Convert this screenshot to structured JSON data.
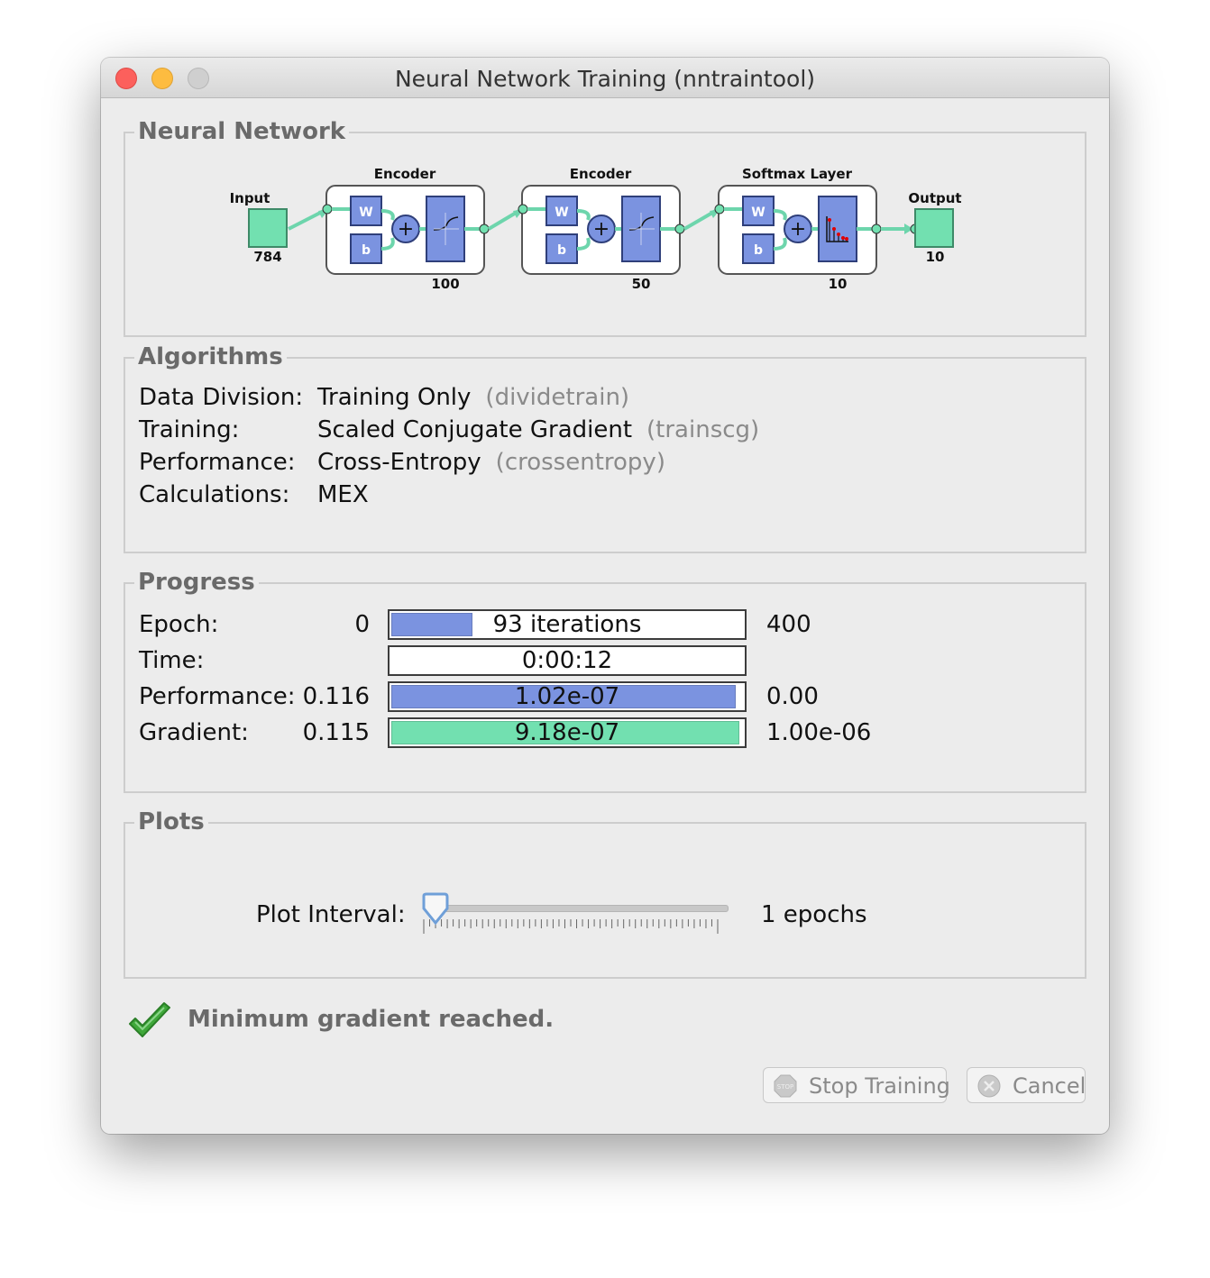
{
  "window": {
    "title": "Neural Network Training (nntraintool)"
  },
  "network": {
    "section_title": "Neural Network",
    "input": {
      "label": "Input",
      "size": "784"
    },
    "layers": [
      {
        "label": "Encoder",
        "size": "100",
        "transfer": "logsig"
      },
      {
        "label": "Encoder",
        "size": "50",
        "transfer": "logsig"
      },
      {
        "label": "Softmax Layer",
        "size": "10",
        "transfer": "softmax"
      }
    ],
    "weight_label": "W",
    "bias_label": "b",
    "output": {
      "label": "Output",
      "size": "10"
    },
    "colors": {
      "io_box": "#72e0b0",
      "layer_block": "#7b93e0",
      "connection": "#6dd5ac"
    }
  },
  "algorithms": {
    "section_title": "Algorithms",
    "rows": [
      {
        "label": "Data Division:",
        "value": "Training Only",
        "function": "(dividetrain)"
      },
      {
        "label": "Training:",
        "value": "Scaled Conjugate Gradient",
        "function": "(trainscg)"
      },
      {
        "label": "Performance:",
        "value": "Cross-Entropy",
        "function": "(crossentropy)"
      },
      {
        "label": "Calculations:",
        "value": "MEX",
        "function": ""
      }
    ]
  },
  "progress": {
    "section_title": "Progress",
    "rows": [
      {
        "label": "Epoch:",
        "min": "0",
        "text": "93 iterations",
        "max": "400",
        "fill": 0.232,
        "color": "#7b93e0"
      },
      {
        "label": "Time:",
        "min": "",
        "text": "0:00:12",
        "max": "",
        "fill": 0,
        "color": "#7b93e0"
      },
      {
        "label": "Performance:",
        "min": "0.116",
        "text": "1.02e-07",
        "max": "0.00",
        "fill": 0.98,
        "color": "#7b93e0"
      },
      {
        "label": "Gradient:",
        "min": "0.115",
        "text": "9.18e-07",
        "max": "1.00e-06",
        "fill": 0.99,
        "color": "#72e0b0"
      }
    ]
  },
  "plots": {
    "section_title": "Plots",
    "interval_label": "Plot Interval:",
    "interval_value": "1 epochs",
    "slider_fraction": 0
  },
  "status": {
    "message": "Minimum gradient reached.",
    "icon": "checkmark-icon",
    "icon_color": "#3fa83a"
  },
  "buttons": {
    "stop": {
      "label": "Stop Training",
      "icon": "stop-icon"
    },
    "cancel": {
      "label": "Cancel",
      "icon": "cancel-icon"
    }
  }
}
